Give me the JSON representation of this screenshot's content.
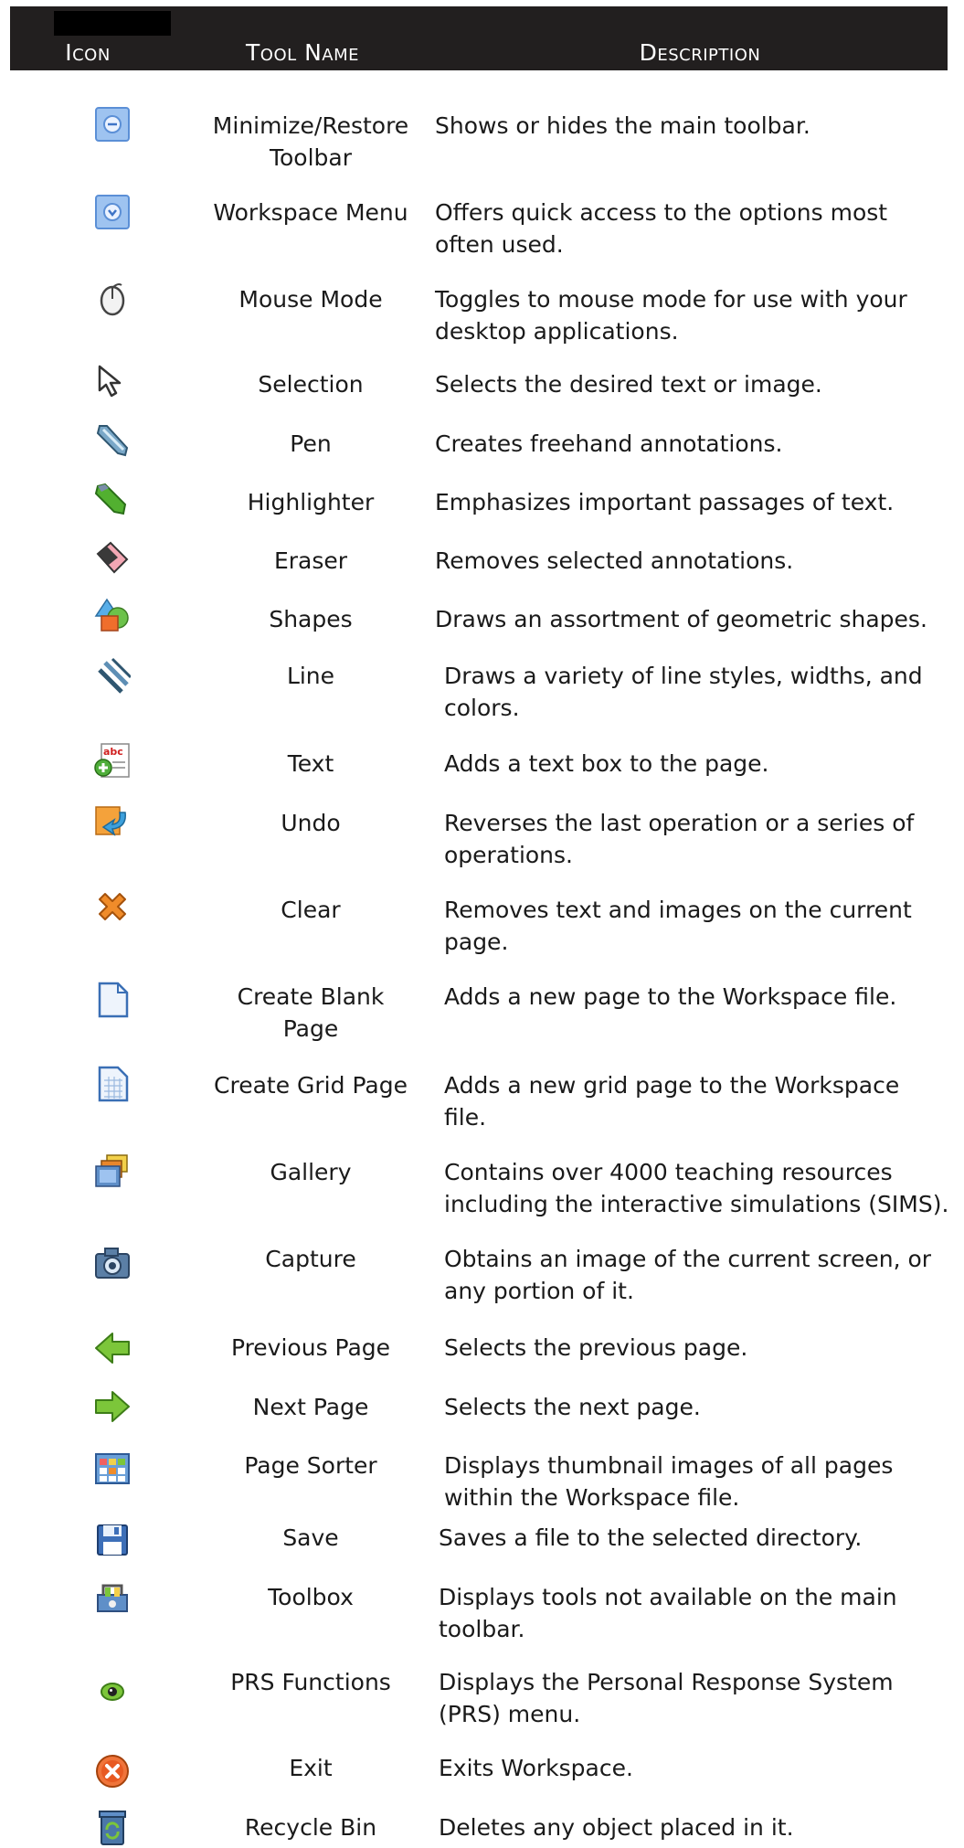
{
  "header": {
    "icon": "Icon",
    "tool_name": "Tool Name",
    "description": "Description"
  },
  "rows": [
    {
      "icon": "minimize-toolbar-icon",
      "name": "Minimize/Restore\nToolbar",
      "desc": "Shows or hides the main toolbar."
    },
    {
      "icon": "workspace-menu-icon",
      "name": "Workspace Menu",
      "desc": "Offers quick access to the options most\noften used."
    },
    {
      "icon": "mouse-icon",
      "name": "Mouse Mode",
      "desc": "Toggles to mouse mode for use with your\ndesktop applications."
    },
    {
      "icon": "selection-arrow-icon",
      "name": "Selection",
      "desc": "Selects the desired text or image."
    },
    {
      "icon": "pen-icon",
      "name": "Pen",
      "desc": "Creates freehand annotations."
    },
    {
      "icon": "highlighter-icon",
      "name": "Highlighter",
      "desc": "Emphasizes important passages of text."
    },
    {
      "icon": "eraser-icon",
      "name": "Eraser",
      "desc": "Removes selected annotations."
    },
    {
      "icon": "shapes-icon",
      "name": "Shapes",
      "desc": "Draws an assortment of geometric shapes."
    },
    {
      "icon": "line-icon",
      "name": "Line",
      "desc": "Draws a variety of line styles, widths, and\ncolors."
    },
    {
      "icon": "text-icon",
      "name": "Text",
      "desc": "Adds a text box to the page."
    },
    {
      "icon": "undo-icon",
      "name": "Undo",
      "desc": "Reverses the last operation or a series of\noperations."
    },
    {
      "icon": "clear-icon",
      "name": "Clear",
      "desc": "Removes text and images on the current\npage."
    },
    {
      "icon": "blank-page-icon",
      "name": "Create Blank\nPage",
      "desc": "Adds a new page to the Workspace file."
    },
    {
      "icon": "grid-page-icon",
      "name": "Create Grid Page",
      "desc": "Adds a new grid page to the Workspace\nfile."
    },
    {
      "icon": "gallery-icon",
      "name": "Gallery",
      "desc": "Contains over 4000 teaching resources\nincluding the interactive simulations (SIMS)."
    },
    {
      "icon": "camera-icon",
      "name": "Capture",
      "desc": "Obtains an image of the current screen, or\nany portion of it."
    },
    {
      "icon": "previous-page-icon",
      "name": "Previous Page",
      "desc": "Selects the previous page."
    },
    {
      "icon": "next-page-icon",
      "name": "Next Page",
      "desc": "Selects the next page."
    },
    {
      "icon": "page-sorter-icon",
      "name": "Page Sorter",
      "desc": "Displays thumbnail images of all pages\nwithin the Workspace file."
    },
    {
      "icon": "save-icon",
      "name": "Save",
      "desc": "Saves a file to the selected directory."
    },
    {
      "icon": "toolbox-icon",
      "name": "Toolbox",
      "desc": "Displays tools not available on the main\ntoolbar."
    },
    {
      "icon": "prs-icon",
      "name": "PRS Functions",
      "desc": "Displays the Personal Response System\n(PRS) menu."
    },
    {
      "icon": "exit-icon",
      "name": "Exit",
      "desc": "Exits Workspace."
    },
    {
      "icon": "recycle-bin-icon",
      "name": "Recycle Bin",
      "desc": "Deletes any object placed in it."
    }
  ]
}
